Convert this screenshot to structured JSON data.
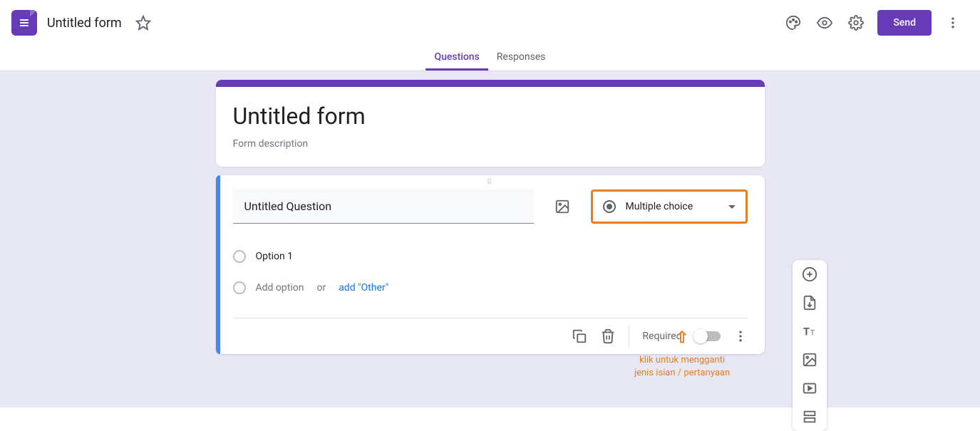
{
  "header": {
    "app_title": "Untitled form",
    "send_label": "Send"
  },
  "tabs": {
    "questions": "Questions",
    "responses": "Responses"
  },
  "form": {
    "title": "Untitled form",
    "description_placeholder": "Form description"
  },
  "question": {
    "title": "Untitled Question",
    "type_label": "Multiple choice",
    "option1": "Option 1",
    "add_option": "Add option",
    "or_text": "or",
    "add_other": "add \"Other\"",
    "required_label": "Required"
  },
  "annotation": {
    "line1": "klik untuk mengganti",
    "line2": "jenis isian / pertanyaan"
  }
}
